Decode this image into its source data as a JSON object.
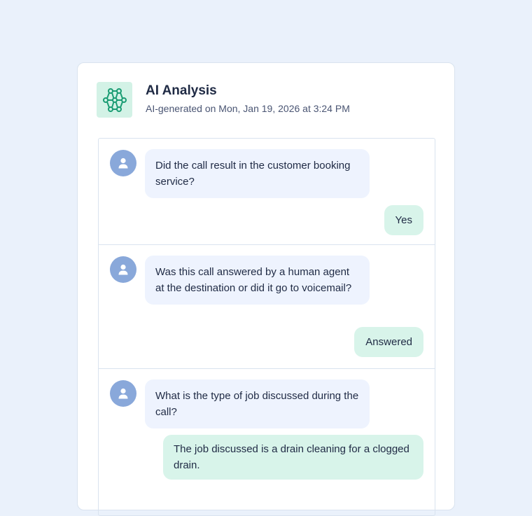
{
  "header": {
    "title": "AI Analysis",
    "subtitle": "AI-generated on Mon, Jan 19, 2026 at 3:24 PM",
    "logo_icon": "network-nodes-icon",
    "accent_color": "#1a9c73"
  },
  "thread": [
    {
      "question": "Did the call result in the customer booking service?",
      "answer": "Yes"
    },
    {
      "question": "Was this call answered by a human agent at the destination or did it go to voicemail?",
      "answer": "Answered"
    },
    {
      "question": "What is the type of job discussed during the call?",
      "answer": "The job discussed is a drain cleaning for a clogged drain."
    }
  ],
  "colors": {
    "question_bubble": "#eef3fe",
    "answer_bubble": "#d8f4ea",
    "avatar": "#89a8da"
  }
}
